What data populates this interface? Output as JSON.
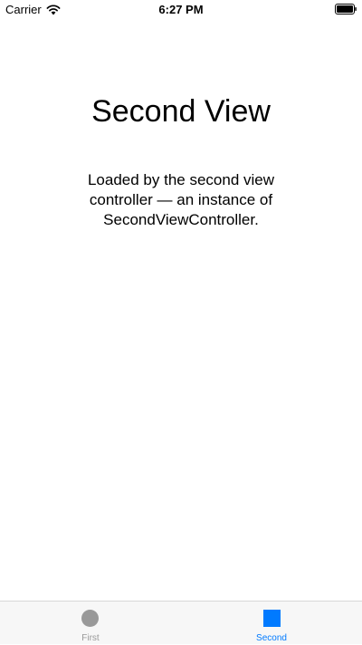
{
  "status_bar": {
    "carrier": "Carrier",
    "time": "6:27 PM",
    "wifi_icon": "wifi-icon",
    "battery_icon": "battery-icon"
  },
  "main": {
    "title": "Second View",
    "body_lines": [
      "Loaded by the second view",
      "controller — an instance of",
      "SecondViewController."
    ]
  },
  "tab_bar": {
    "tabs": [
      {
        "label": "First",
        "icon": "circle-icon",
        "selected": false
      },
      {
        "label": "Second",
        "icon": "square-icon",
        "selected": true
      }
    ]
  },
  "colors": {
    "accent": "#007aff",
    "inactive": "#999999",
    "tab_bar_bg": "#f7f7f7"
  }
}
